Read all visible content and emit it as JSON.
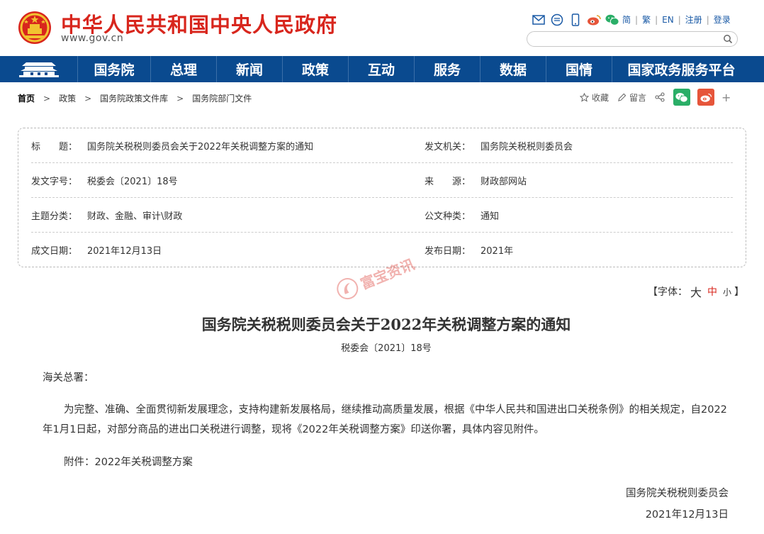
{
  "header": {
    "site_title": "中华人民共和国中央人民政府",
    "site_url": "www.gov.cn",
    "top_links": [
      "简",
      "繁",
      "EN",
      "注册",
      "登录"
    ],
    "search_placeholder": ""
  },
  "nav": {
    "items": [
      "国务院",
      "总理",
      "新闻",
      "政策",
      "互动",
      "服务",
      "数据",
      "国情",
      "国家政务服务平台"
    ]
  },
  "breadcrumb": {
    "items": [
      "首页",
      "政策",
      "国务院政策文件库",
      "国务院部门文件"
    ]
  },
  "tools": {
    "favorite_label": "收藏",
    "comment_label": "留言",
    "plus": "+"
  },
  "info": {
    "title_label": "标　　题：",
    "title_value": "国务院关税税则委员会关于2022年关税调整方案的通知",
    "issuer_label": "发文机关：",
    "issuer_value": "国务院关税税则委员会",
    "doc_no_label": "发文字号：",
    "doc_no_value": "税委会〔2021〕18号",
    "source_label": "来　　源：",
    "source_value": "财政部网站",
    "topic_label": "主题分类：",
    "topic_value": "财政、金融、审计\\财政",
    "type_label": "公文种类：",
    "type_value": "通知",
    "written_label": "成文日期：",
    "written_value": "2021年12月13日",
    "published_label": "发布日期：",
    "published_value": "2021年"
  },
  "watermark": {
    "text": "富宝资讯"
  },
  "font_size": {
    "prefix": "【字体：",
    "large": "大",
    "medium": "中",
    "small": "小",
    "suffix": "】"
  },
  "document": {
    "title": "国务院关税税则委员会关于2022年关税调整方案的通知",
    "number": "税委会〔2021〕18号",
    "salutation": "海关总署：",
    "paragraph": "为完整、准确、全面贯彻新发展理念，支持构建新发展格局，继续推动高质量发展，根据《中华人民共和国进出口关税条例》的相关规定，自2022年1月1日起，对部分商品的进出口关税进行调整，现将《2022年关税调整方案》印送你署，具体内容见附件。",
    "attachment": "附件：2022年关税调整方案",
    "signature_org": "国务院关税税则委员会",
    "signature_date": "2021年12月13日"
  },
  "colors": {
    "brand_red": "#d8261d",
    "nav_blue": "#0a4a8f",
    "link_blue": "#1a5aa6",
    "wechat_green": "#2aae67",
    "weibo_orange": "#e6553a"
  }
}
